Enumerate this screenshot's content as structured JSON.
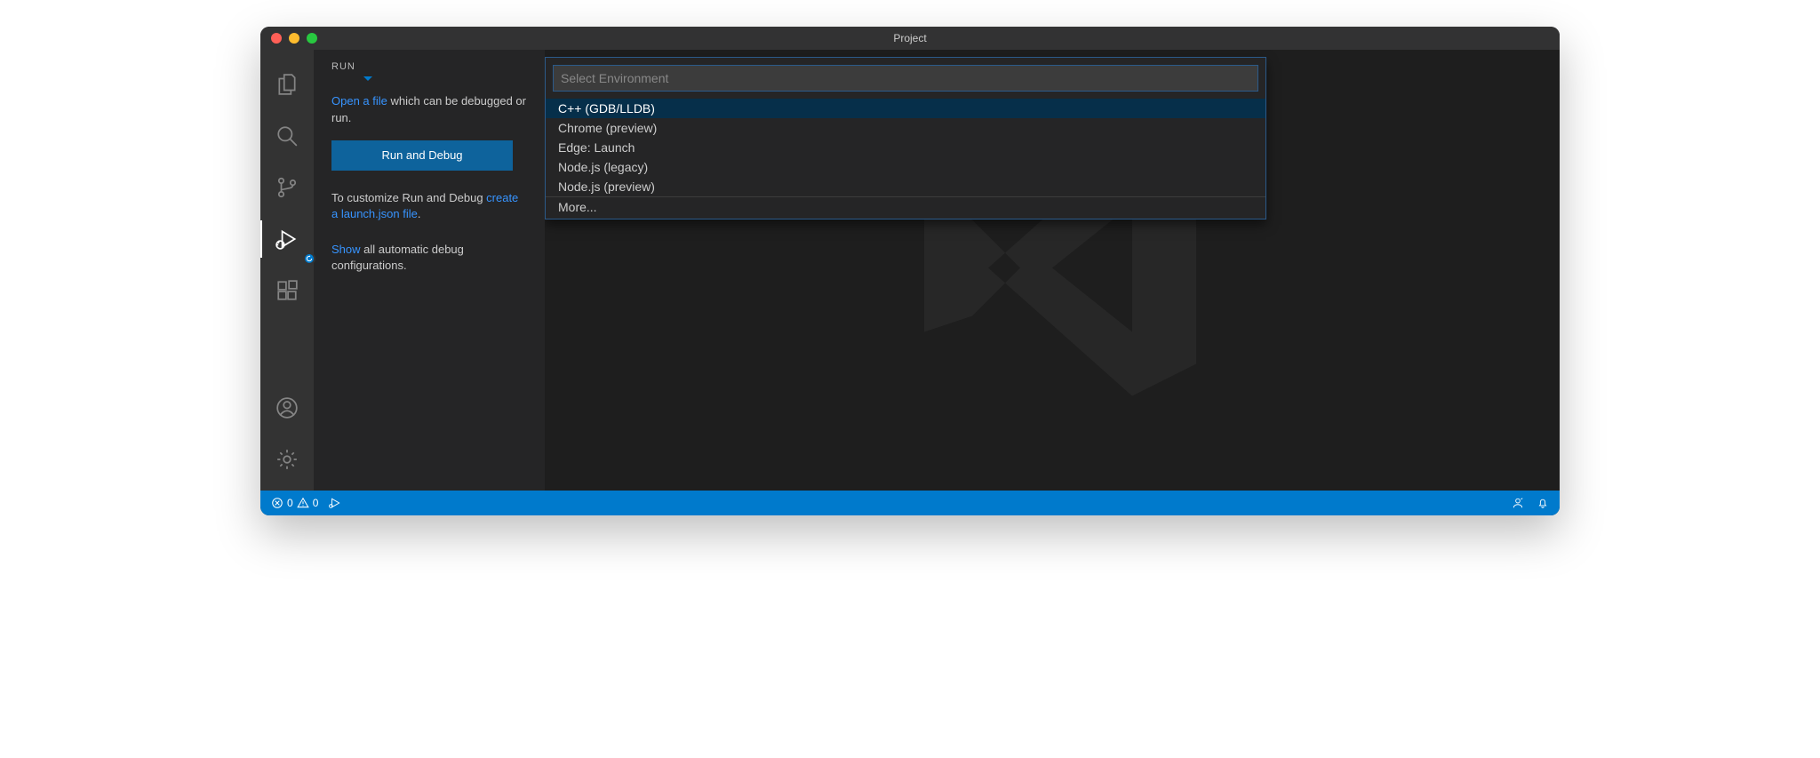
{
  "window": {
    "title": "Project"
  },
  "sidebar": {
    "title": "RUN",
    "open_file_link": "Open a file",
    "open_file_tail": " which can be debugged or run.",
    "run_button": "Run and Debug",
    "customize_pre": "To customize Run and Debug ",
    "create_link": "create a launch.json file",
    "customize_post": ".",
    "show_link": "Show",
    "show_tail": " all automatic debug configurations."
  },
  "quickinput": {
    "placeholder": "Select Environment",
    "items": [
      "C++ (GDB/LLDB)",
      "Chrome (preview)",
      "Edge: Launch",
      "Node.js (legacy)",
      "Node.js (preview)"
    ],
    "more": "More..."
  },
  "statusbar": {
    "errors": "0",
    "warnings": "0"
  }
}
